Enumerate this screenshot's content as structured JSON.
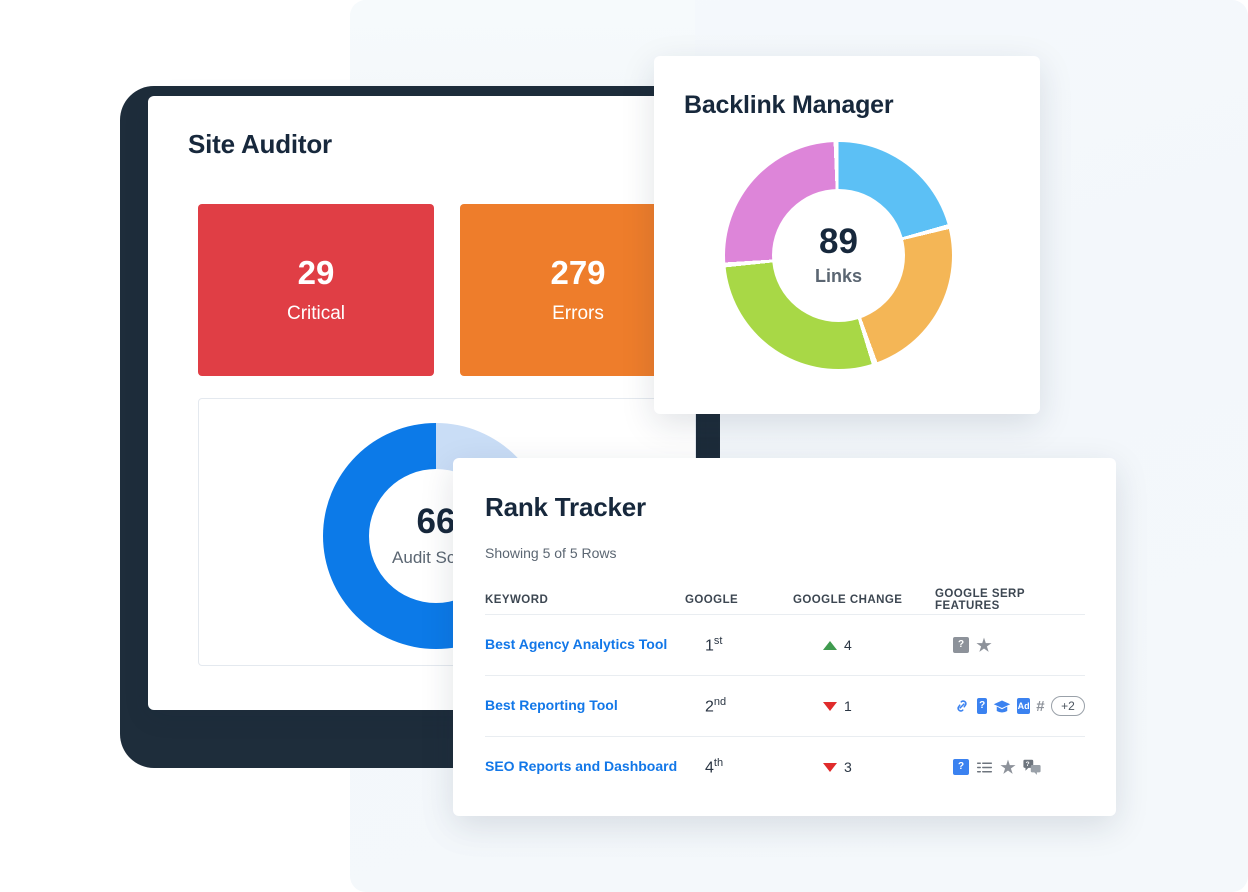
{
  "site_auditor": {
    "title": "Site Auditor",
    "metrics": [
      {
        "value": "29",
        "label": "Critical",
        "color": "#e03e45"
      },
      {
        "value": "279",
        "label": "Errors",
        "color": "#ee7d2b"
      }
    ],
    "audit_score": {
      "value": "66",
      "label": "Audit Score",
      "percent": 66,
      "arc_color": "#0c7ae8",
      "track_color": "#c9ddf6"
    }
  },
  "backlink_manager": {
    "title": "Backlink Manager",
    "total": "89",
    "total_label": "Links",
    "segments": [
      {
        "name": "blue",
        "color": "#5cc0f5",
        "percent": 21
      },
      {
        "name": "orange",
        "color": "#f4b656",
        "percent": 23
      },
      {
        "name": "green",
        "color": "#a8d846",
        "percent": 28
      },
      {
        "name": "pink",
        "color": "#dd85d9",
        "percent": 26
      }
    ]
  },
  "rank_tracker": {
    "title": "Rank Tracker",
    "showing": "Showing 5 of 5 Rows",
    "columns": [
      "KEYWORD",
      "GOOGLE",
      "GOOGLE CHANGE",
      "GOOGLE SERP FEATURES"
    ],
    "rows": [
      {
        "keyword": "Best Agency Analytics Tool",
        "rank": "1",
        "rank_suffix": "st",
        "change_dir": "up",
        "change_value": "4",
        "features": [
          {
            "icon": "question-box-icon",
            "glyph": "?",
            "style": "gray"
          },
          {
            "icon": "star-icon",
            "glyph": "★",
            "style": "star"
          }
        ],
        "extra": ""
      },
      {
        "keyword": "Best Reporting Tool",
        "rank": "2",
        "rank_suffix": "nd",
        "change_dir": "down",
        "change_value": "1",
        "features": [
          {
            "icon": "sitelink-chain-icon",
            "glyph": "",
            "style": "svg-link"
          },
          {
            "icon": "question-box-icon",
            "glyph": "?",
            "style": "blue"
          },
          {
            "icon": "graduation-cap-icon",
            "glyph": "",
            "style": "svg-cap"
          },
          {
            "icon": "ad-box-icon",
            "glyph": "Ad",
            "style": "blue"
          },
          {
            "icon": "hash-icon",
            "glyph": "#",
            "style": "plain"
          }
        ],
        "extra": "+2"
      },
      {
        "keyword": "SEO Reports and Dashboard",
        "rank": "4",
        "rank_suffix": "th",
        "change_dir": "down",
        "change_value": "3",
        "features": [
          {
            "icon": "question-box-icon",
            "glyph": "?",
            "style": "blue"
          },
          {
            "icon": "featured-snippet-icon",
            "glyph": "",
            "style": "svg-snippet"
          },
          {
            "icon": "star-icon",
            "glyph": "★",
            "style": "star"
          },
          {
            "icon": "qa-bubble-icon",
            "glyph": "",
            "style": "svg-qa"
          }
        ],
        "extra": ""
      }
    ]
  },
  "theme": {
    "dark_card": "#1e2d3b",
    "bg_panel": "#f4f8fb",
    "link_blue": "#1277e8",
    "heading": "#17283c",
    "up_green": "#3f9b4f",
    "down_red": "#e02b2b"
  }
}
